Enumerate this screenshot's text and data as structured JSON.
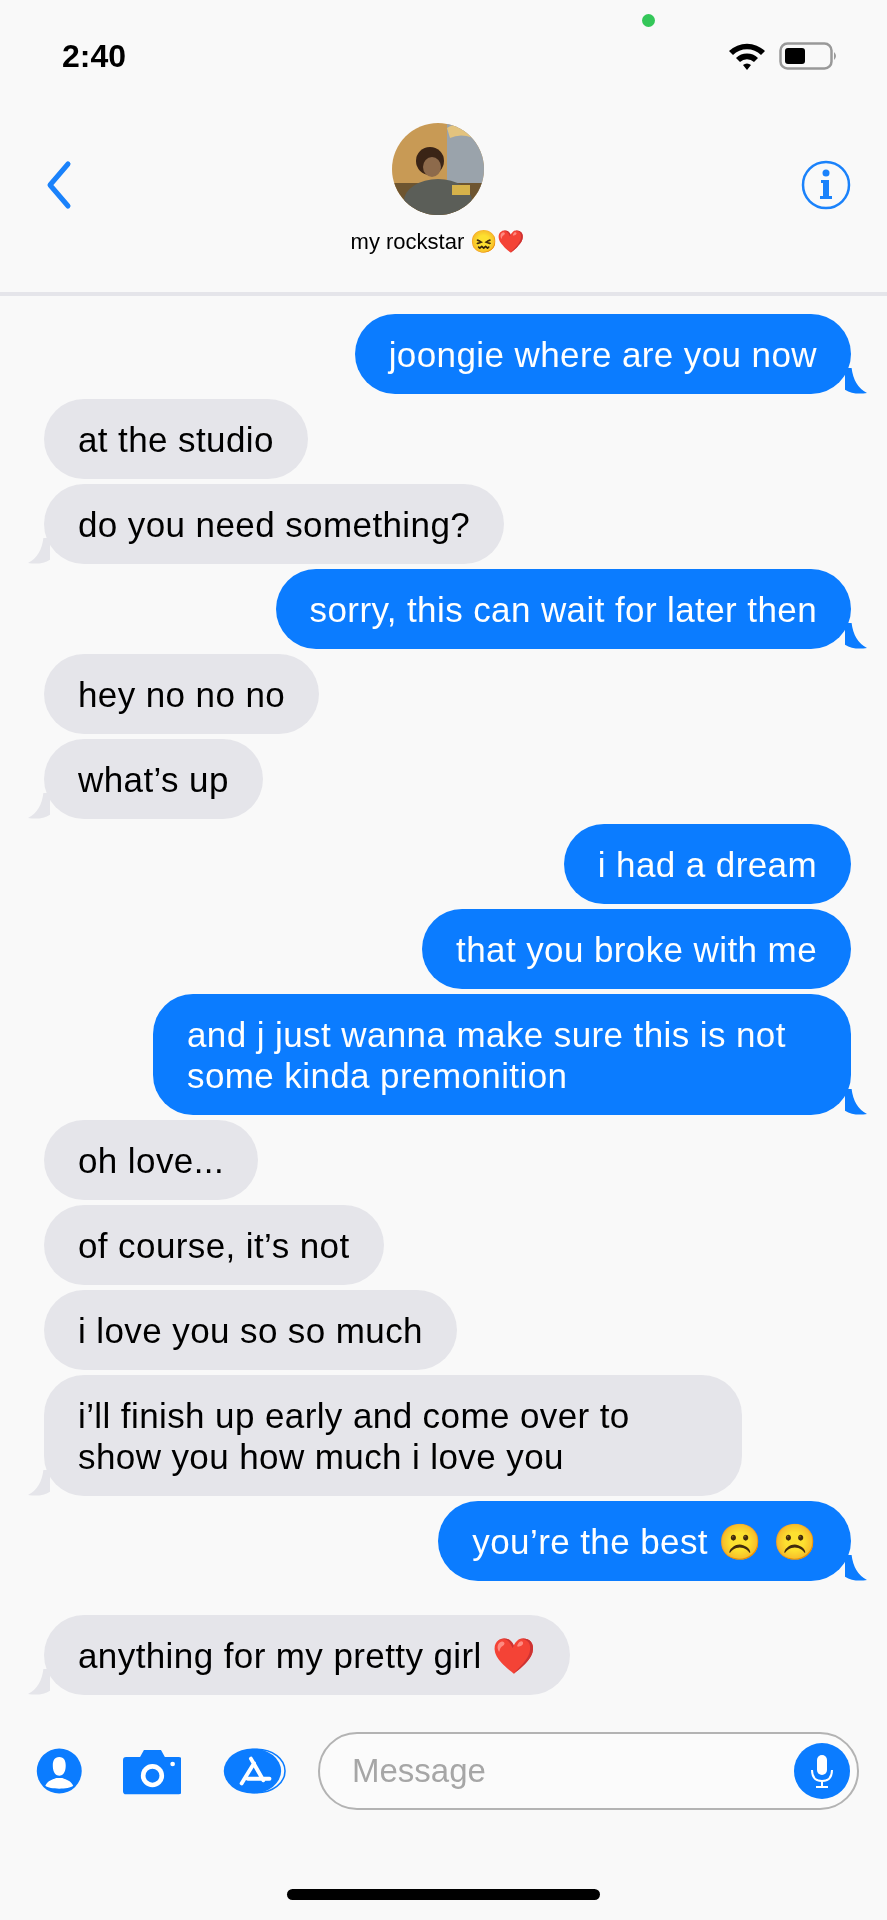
{
  "status_bar": {
    "time": "2:40"
  },
  "header": {
    "contact_name": "my rockstar 😖❤️"
  },
  "messages": [
    {
      "kind": "sent",
      "text": "joongie where are you now",
      "tail": true
    },
    {
      "kind": "received",
      "text": "at the studio",
      "tail": false
    },
    {
      "kind": "received",
      "text": "do you need something?",
      "tail": true
    },
    {
      "kind": "sent",
      "text": "sorry, this can wait for later then",
      "tail": true
    },
    {
      "kind": "received",
      "text": "hey no no no",
      "tail": false
    },
    {
      "kind": "received",
      "text": "what’s up",
      "tail": true
    },
    {
      "kind": "sent",
      "text": "i had a dream",
      "tail": false
    },
    {
      "kind": "sent",
      "text": "that you broke with me",
      "tail": false
    },
    {
      "kind": "sent",
      "text": "and j just wanna make sure this is not some kinda premonition",
      "tail": true
    },
    {
      "kind": "received",
      "text": "oh love...",
      "tail": false
    },
    {
      "kind": "received",
      "text": "of course, it’s not",
      "tail": false
    },
    {
      "kind": "received",
      "text": "i love you so so much",
      "tail": false
    },
    {
      "kind": "received",
      "text": "i’ll finish up early and come over to show you how much i love you",
      "tail": true
    },
    {
      "kind": "sent",
      "text": "you’re the best ☹️ ☹️",
      "tail": true
    },
    {
      "kind": "received",
      "text": "anything for my pretty girl ❤️",
      "tail": true
    }
  ],
  "composer": {
    "placeholder": "Message"
  }
}
